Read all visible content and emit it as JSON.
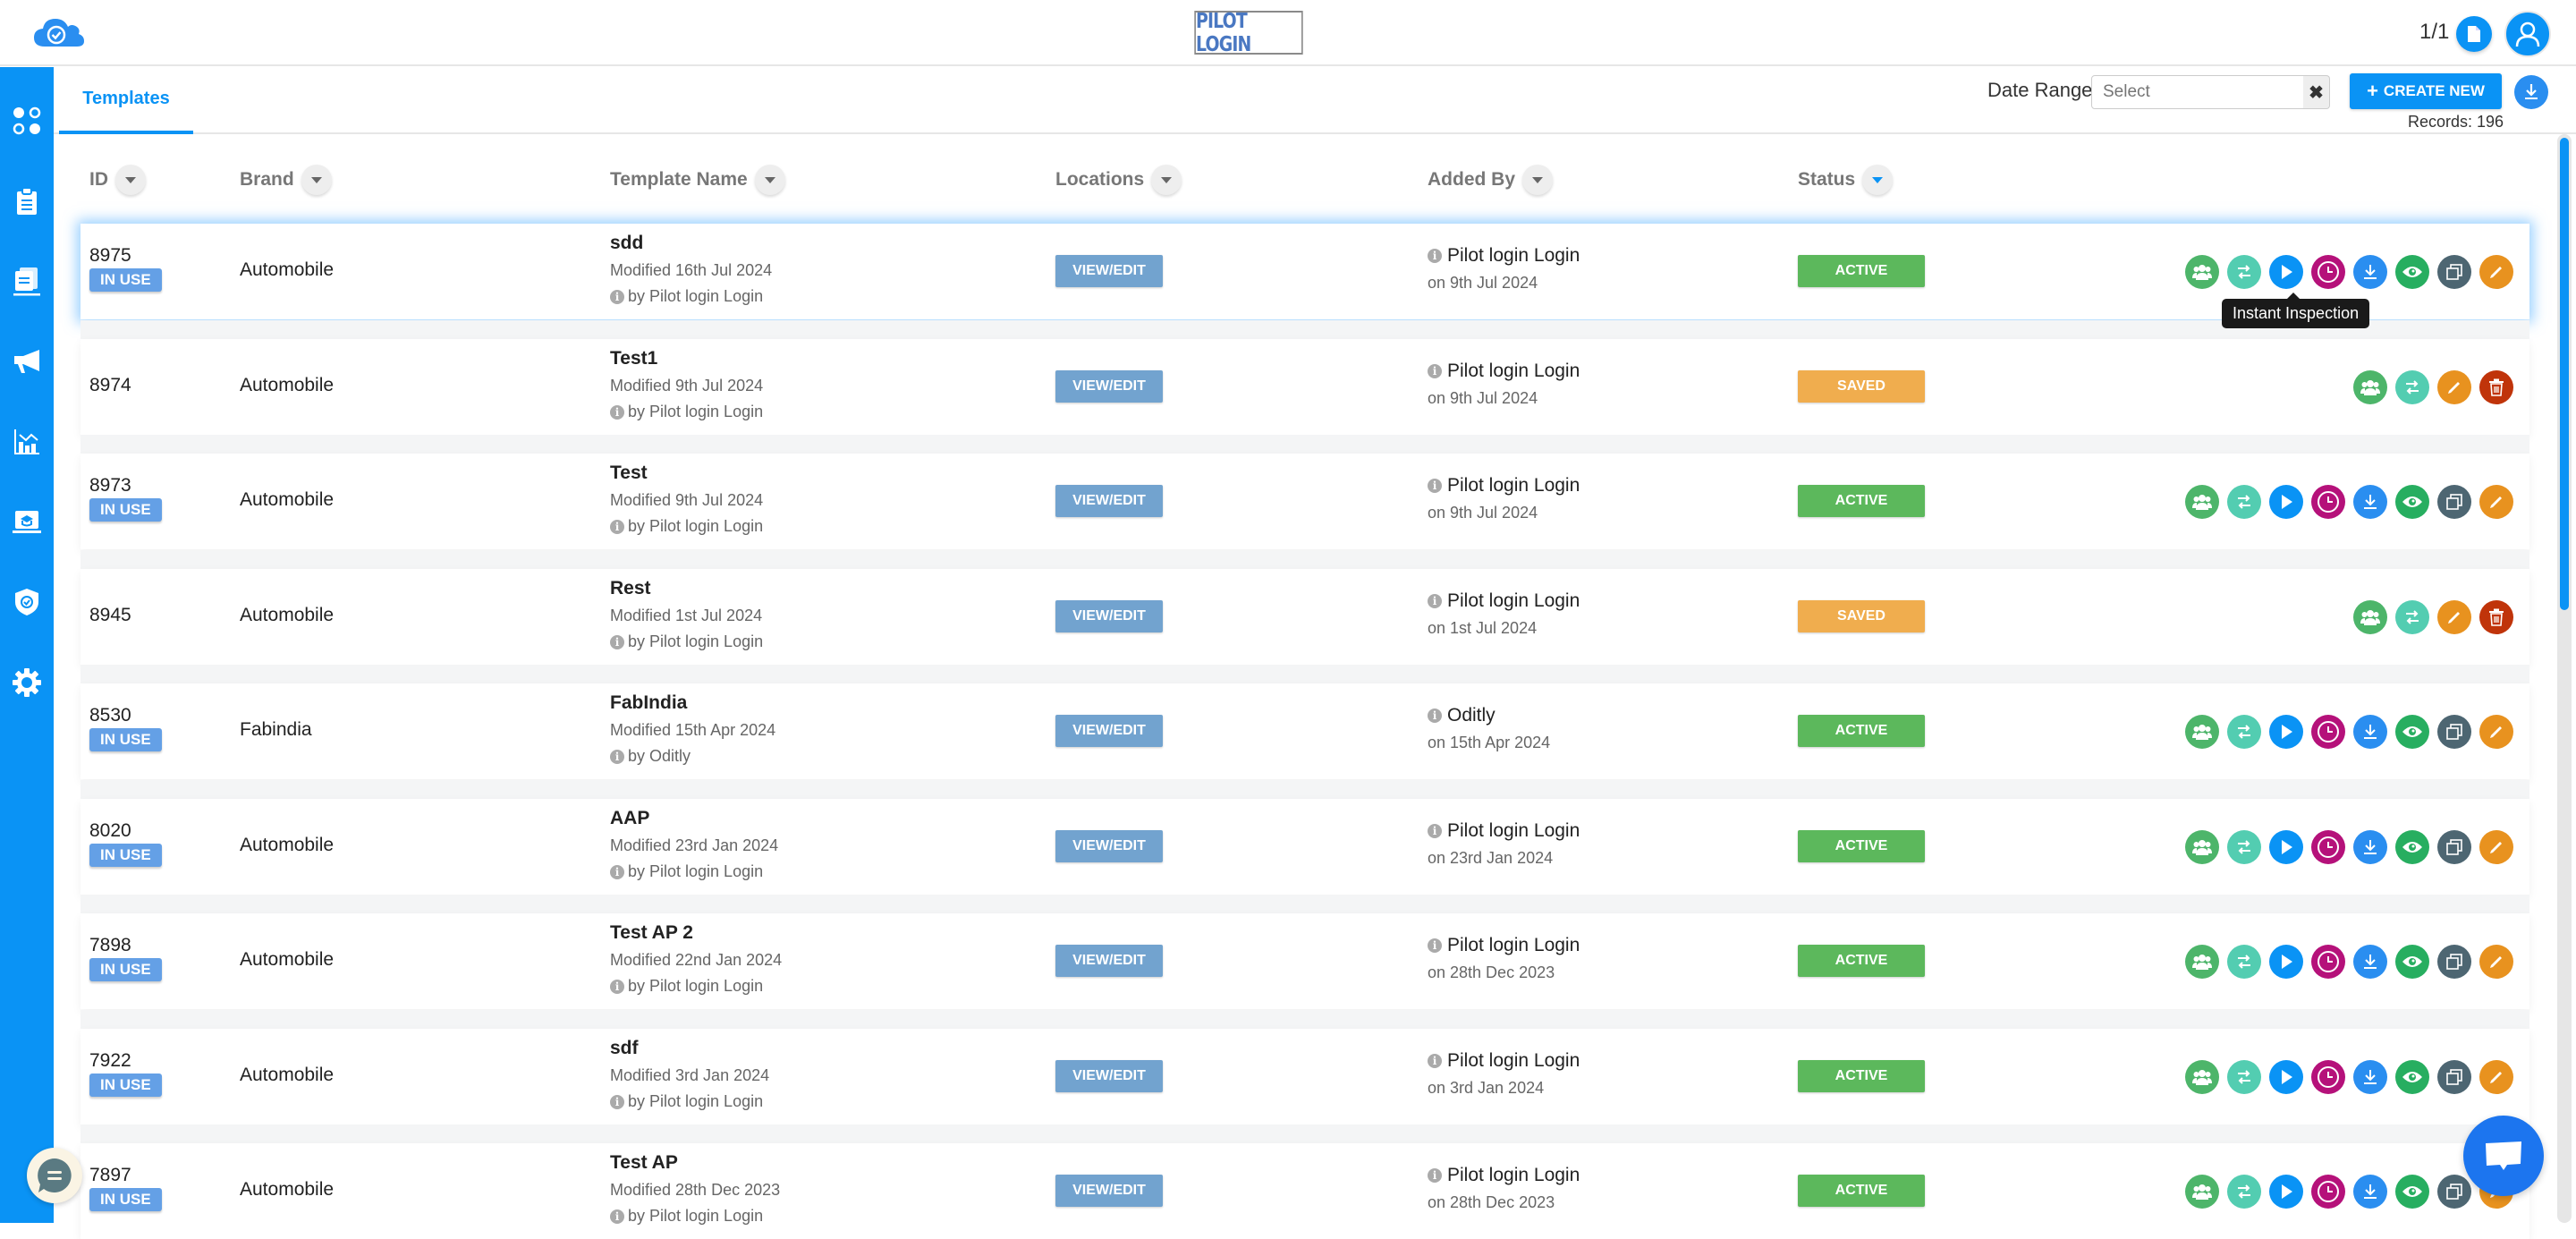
{
  "header": {
    "brand_text": "PILOT LOGIN",
    "page_count": "1/1",
    "logo_icon": "cloud-check-icon",
    "doc_icon": "document-icon",
    "user_icon": "user-icon"
  },
  "sidebar": {
    "items": [
      {
        "name": "dashboard",
        "icon": "dots-grid-icon"
      },
      {
        "name": "clipboard",
        "icon": "clipboard-icon"
      },
      {
        "name": "templates",
        "icon": "documents-icon"
      },
      {
        "name": "announcements",
        "icon": "megaphone-icon"
      },
      {
        "name": "analytics",
        "icon": "chart-icon"
      },
      {
        "name": "training",
        "icon": "laptop-graduation-icon"
      },
      {
        "name": "security",
        "icon": "shield-check-icon"
      },
      {
        "name": "settings",
        "icon": "gear-icon"
      }
    ]
  },
  "tabs": [
    {
      "label": "Templates",
      "active": true
    }
  ],
  "toolbar": {
    "date_range_label": "Date Range",
    "date_placeholder": "Select",
    "clear_label": "✖",
    "create_label": "CREATE NEW",
    "create_icon": "+",
    "records_label": "Records: 196"
  },
  "columns": [
    {
      "label": "ID",
      "sort_active": false
    },
    {
      "label": "Brand",
      "sort_active": false
    },
    {
      "label": "Template Name",
      "sort_active": false
    },
    {
      "label": "Locations",
      "sort_active": false
    },
    {
      "label": "Added By",
      "sort_active": false
    },
    {
      "label": "Status",
      "sort_active": true
    }
  ],
  "view_edit_label": "VIEW/EDIT",
  "tooltip": "Instant Inspection",
  "colors": {
    "primary": "#0a93f5",
    "active": "#5cb85c",
    "saved": "#f0ad4e",
    "in_use": "#64a0e6",
    "view_edit": "#72a3cf"
  },
  "rows": [
    {
      "id": "8975",
      "in_use": true,
      "brand": "Automobile",
      "name": "sdd",
      "modified": "Modified 16th Jul 2024",
      "by": "by Pilot login Login",
      "added_by": "Pilot login Login",
      "added_on": "on 9th Jul 2024",
      "status": "ACTIVE",
      "selected": true
    },
    {
      "id": "8974",
      "in_use": false,
      "brand": "Automobile",
      "name": "Test1",
      "modified": "Modified 9th Jul 2024",
      "by": "by Pilot login Login",
      "added_by": "Pilot login Login",
      "added_on": "on 9th Jul 2024",
      "status": "SAVED",
      "selected": false
    },
    {
      "id": "8973",
      "in_use": true,
      "brand": "Automobile",
      "name": "Test",
      "modified": "Modified 9th Jul 2024",
      "by": "by Pilot login Login",
      "added_by": "Pilot login Login",
      "added_on": "on 9th Jul 2024",
      "status": "ACTIVE",
      "selected": false
    },
    {
      "id": "8945",
      "in_use": false,
      "brand": "Automobile",
      "name": "Rest",
      "modified": "Modified 1st Jul 2024",
      "by": "by Pilot login Login",
      "added_by": "Pilot login Login",
      "added_on": "on 1st Jul 2024",
      "status": "SAVED",
      "selected": false
    },
    {
      "id": "8530",
      "in_use": true,
      "brand": "Fabindia",
      "name": "FabIndia",
      "modified": "Modified 15th Apr 2024",
      "by": "by Oditly",
      "added_by": "Oditly",
      "added_on": "on 15th Apr 2024",
      "status": "ACTIVE",
      "selected": false
    },
    {
      "id": "8020",
      "in_use": true,
      "brand": "Automobile",
      "name": "AAP",
      "modified": "Modified 23rd Jan 2024",
      "by": "by Pilot login Login",
      "added_by": "Pilot login Login",
      "added_on": "on 23rd Jan 2024",
      "status": "ACTIVE",
      "selected": false
    },
    {
      "id": "7898",
      "in_use": true,
      "brand": "Automobile",
      "name": "Test AP 2",
      "modified": "Modified 22nd Jan 2024",
      "by": "by Pilot login Login",
      "added_by": "Pilot login Login",
      "added_on": "on 28th Dec 2023",
      "status": "ACTIVE",
      "selected": false
    },
    {
      "id": "7922",
      "in_use": true,
      "brand": "Automobile",
      "name": "sdf",
      "modified": "Modified 3rd Jan 2024",
      "by": "by Pilot login Login",
      "added_by": "Pilot login Login",
      "added_on": "on 3rd Jan 2024",
      "status": "ACTIVE",
      "selected": false
    },
    {
      "id": "7897",
      "in_use": true,
      "brand": "Automobile",
      "name": "Test AP",
      "modified": "Modified 28th Dec 2023",
      "by": "by Pilot login Login",
      "added_by": "Pilot login Login",
      "added_on": "on 28th Dec 2023",
      "status": "ACTIVE",
      "selected": false
    }
  ],
  "actions_active": [
    "assign-users",
    "transfer",
    "instant-inspection",
    "schedule",
    "download",
    "preview",
    "duplicate",
    "edit"
  ],
  "actions_saved": [
    "assign-users",
    "transfer",
    "edit",
    "delete"
  ],
  "in_use_label": "IN USE"
}
